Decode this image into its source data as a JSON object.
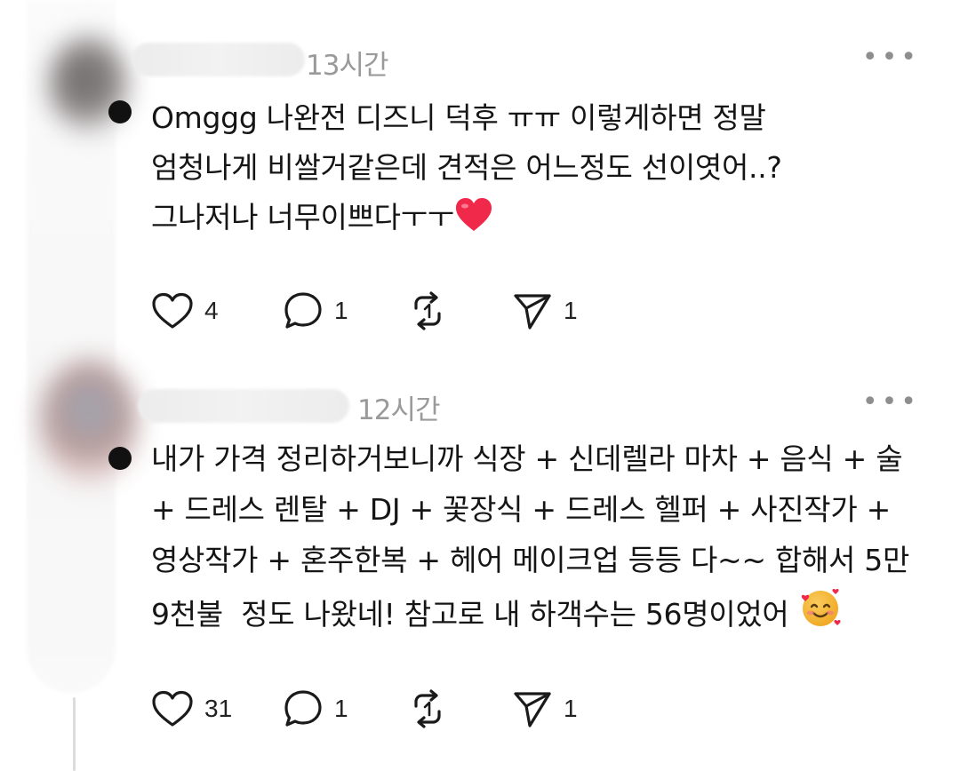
{
  "comments": [
    {
      "time": "13시간",
      "text": "Omggg 나완전 디즈니 덕후 ㅠㅠ 이렇게하면 정말\n엄청나게 비쌀거같은데 견적은 어느정도 선이엿어..?\n그나저나 너무이쁘다ㅜㅜ",
      "emoji": "red-heart",
      "likes": "4",
      "replies": "1",
      "shares": "1"
    },
    {
      "time": "12시간",
      "text": "내가 가격 정리하거보니까 식장 + 신데렐라 마차 + 음식 + 술\n+ 드레스 렌탈 + DJ + 꽃장식 + 드레스 헬퍼 + 사진작가 +\n영상작가 + 혼주한복 + 헤어 메이크업 등등 다~~ 합해서 5만\n9천불  정도 나왔네! 참고로 내 하객수는 56명이었어",
      "emoji": "smiling-face-with-hearts",
      "likes": "31",
      "replies": "1",
      "shares": "1"
    }
  ],
  "icons": {
    "more": "more-horizontal-icon",
    "like": "heart-outline-icon",
    "reply": "speech-bubble-icon",
    "repost": "repost-arrows-icon",
    "share": "paper-plane-icon"
  },
  "colors": {
    "text": "#151515",
    "muted": "#9a9a9a",
    "heart": "#f0284a"
  }
}
